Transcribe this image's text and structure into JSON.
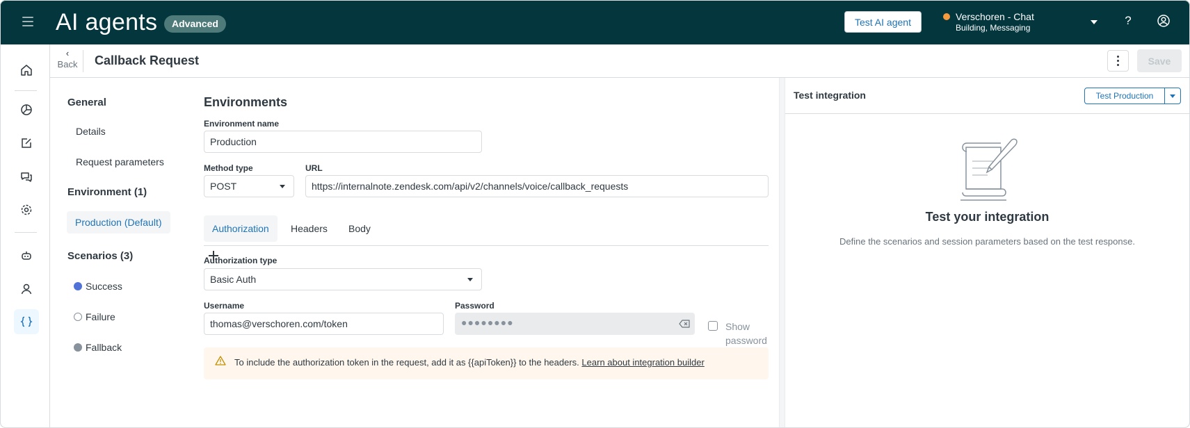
{
  "topbar": {
    "app_title": "AI agents",
    "badge": "Advanced",
    "test_button": "Test AI agent",
    "account_name": "Verschoren - Chat",
    "account_sub": "Building, Messaging",
    "help": "?"
  },
  "leftnav": {
    "items": [
      "home-icon",
      "reports-icon",
      "edit-icon",
      "conversations-icon",
      "settings-icon",
      "bot-icon",
      "user-icon",
      "integrations-icon"
    ]
  },
  "subheader": {
    "back_label": "Back",
    "title": "Callback Request",
    "save_label": "Save"
  },
  "sidebar": {
    "general": "General",
    "details": "Details",
    "request_parameters": "Request parameters",
    "environment_heading": "Environment (1)",
    "environment_active": "Production (Default)",
    "scenarios_heading": "Scenarios (3)",
    "scenarios": [
      {
        "label": "Success",
        "color": "#5172d6"
      },
      {
        "label": "Failure",
        "color": "#ffffff"
      },
      {
        "label": "Fallback",
        "color": "#87929d"
      }
    ]
  },
  "form": {
    "section_title": "Environments",
    "env_name_label": "Environment name",
    "env_name_value": "Production",
    "method_label": "Method type",
    "method_value": "POST",
    "url_label": "URL",
    "url_value": "https://internalnote.zendesk.com/api/v2/channels/voice/callback_requests",
    "tabs": [
      "Authorization",
      "Headers",
      "Body"
    ],
    "auth_type_label": "Authorization type",
    "auth_type_value": "Basic Auth",
    "username_label": "Username",
    "username_value": "thomas@verschoren.com/token",
    "password_label": "Password",
    "password_mask": "●●●●●●●●",
    "show_password": "Show password",
    "notice_text": "To include the authorization token in the request, add it as {{apiToken}} to the headers.",
    "notice_link": "Learn about integration builder"
  },
  "test_panel": {
    "title": "Test integration",
    "env_button": "Test Production",
    "empty_title": "Test your integration",
    "empty_subtitle": "Define the scenarios and session parameters based on the test response."
  }
}
